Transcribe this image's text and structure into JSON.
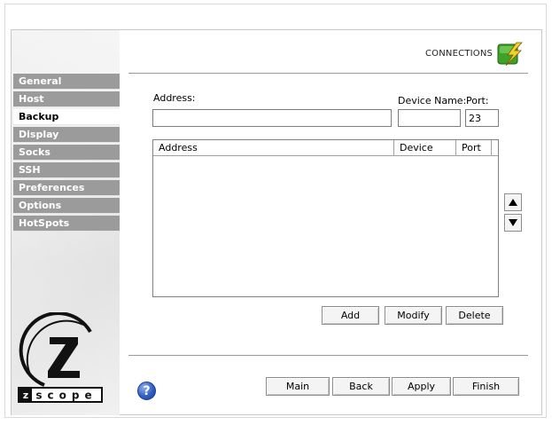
{
  "header": {
    "section_label": "CONNECTIONS",
    "icon": "connections-lightning-icon"
  },
  "sidebar": {
    "items": [
      {
        "label": "General",
        "active": false
      },
      {
        "label": "Host",
        "active": false
      },
      {
        "label": "Backup",
        "active": true
      },
      {
        "label": "Display",
        "active": false
      },
      {
        "label": "Socks",
        "active": false
      },
      {
        "label": "SSH",
        "active": false
      },
      {
        "label": "Preferences",
        "active": false
      },
      {
        "label": "Options",
        "active": false
      },
      {
        "label": "HotSpots",
        "active": false
      }
    ],
    "logo_text": "zscope"
  },
  "form": {
    "address_label": "Address:",
    "address_value": "",
    "device_name_label": "Device Name:",
    "device_name_value": "",
    "port_label": "Port:",
    "port_value": "23"
  },
  "list": {
    "columns": [
      "Address",
      "Device",
      "Port"
    ],
    "rows": []
  },
  "list_actions": {
    "add_label": "Add",
    "modify_label": "Modify",
    "delete_label": "Delete",
    "move_up_icon": "triangle-up-icon",
    "move_down_icon": "triangle-down-icon"
  },
  "footer": {
    "help_icon": "help-icon",
    "main_label": "Main",
    "back_label": "Back",
    "apply_label": "Apply",
    "finish_label": "Finish"
  },
  "colors": {
    "nav_inactive_bg": "#9b9b9b",
    "nav_active_bg": "#ffffff",
    "help_blue": "#2f5fc7",
    "icon_green": "#3fa02a",
    "icon_yellow": "#f2d22a"
  }
}
